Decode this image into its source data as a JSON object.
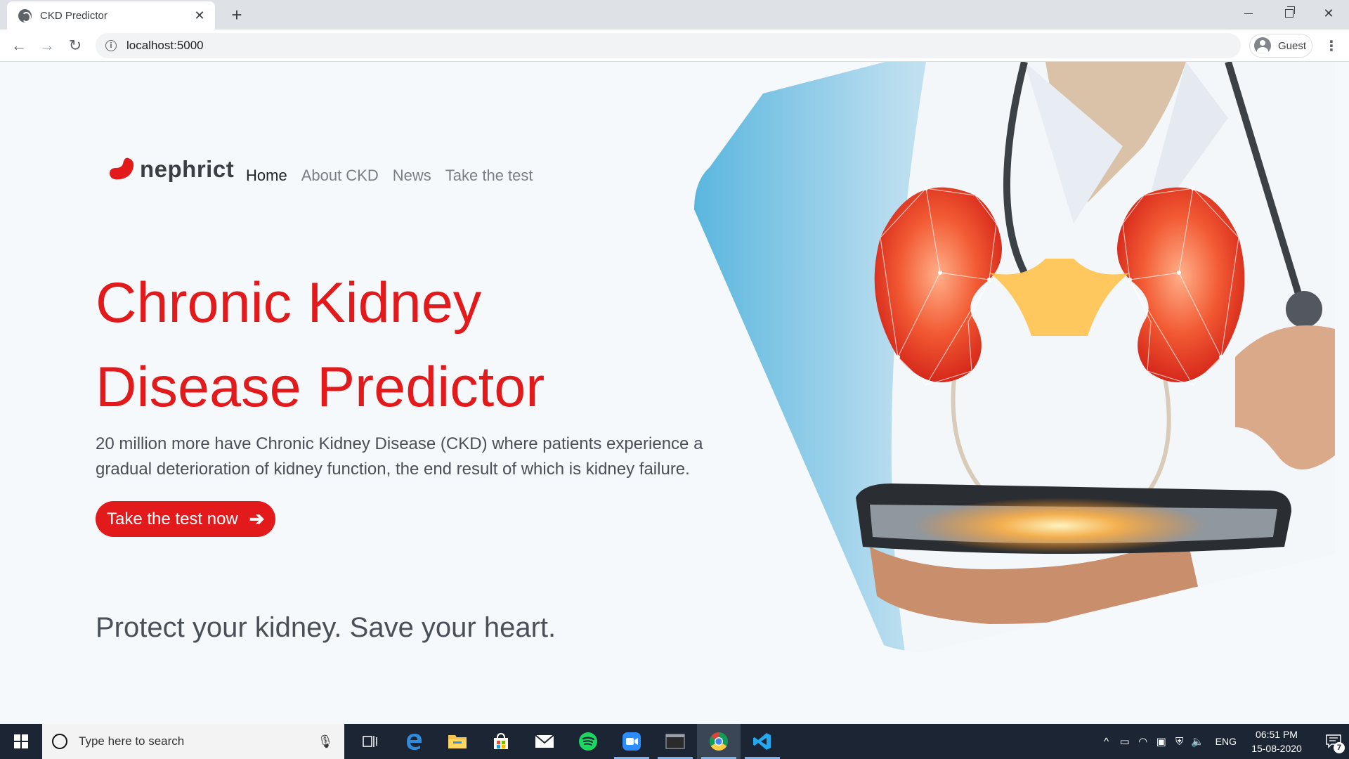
{
  "browser": {
    "tab_title": "CKD Predictor",
    "tab_close": "✕",
    "new_tab": "+",
    "url": "localhost:5000",
    "profile_label": "Guest",
    "menu": "⋮",
    "back": "←",
    "forward": "→",
    "reload": "↻",
    "close": "✕"
  },
  "site": {
    "brand": "nephrict",
    "nav": [
      "Home",
      "About CKD",
      "News",
      "Take the test"
    ],
    "hero_title_line1": "Chronic Kidney",
    "hero_title_line2": "Disease Predictor",
    "hero_text": "20 million more have Chronic Kidney Disease (CKD) where patients experience a gradual deterioration of kidney function, the end result of which is kidney failure.",
    "cta_label": "Take the test now",
    "cta_arrow": "➔",
    "tagline": "Protect your kidney. Save your heart.",
    "accent_color": "#e31a1c"
  },
  "taskbar": {
    "search_placeholder": "Type here to search",
    "mic": "🎙",
    "lang": "ENG",
    "time": "06:51 PM",
    "date": "15-08-2020",
    "notification_count": "7",
    "apps": [
      "task-view",
      "edge",
      "file-explorer",
      "store",
      "mail",
      "spotify",
      "zoom",
      "terminal",
      "chrome",
      "vscode"
    ]
  }
}
